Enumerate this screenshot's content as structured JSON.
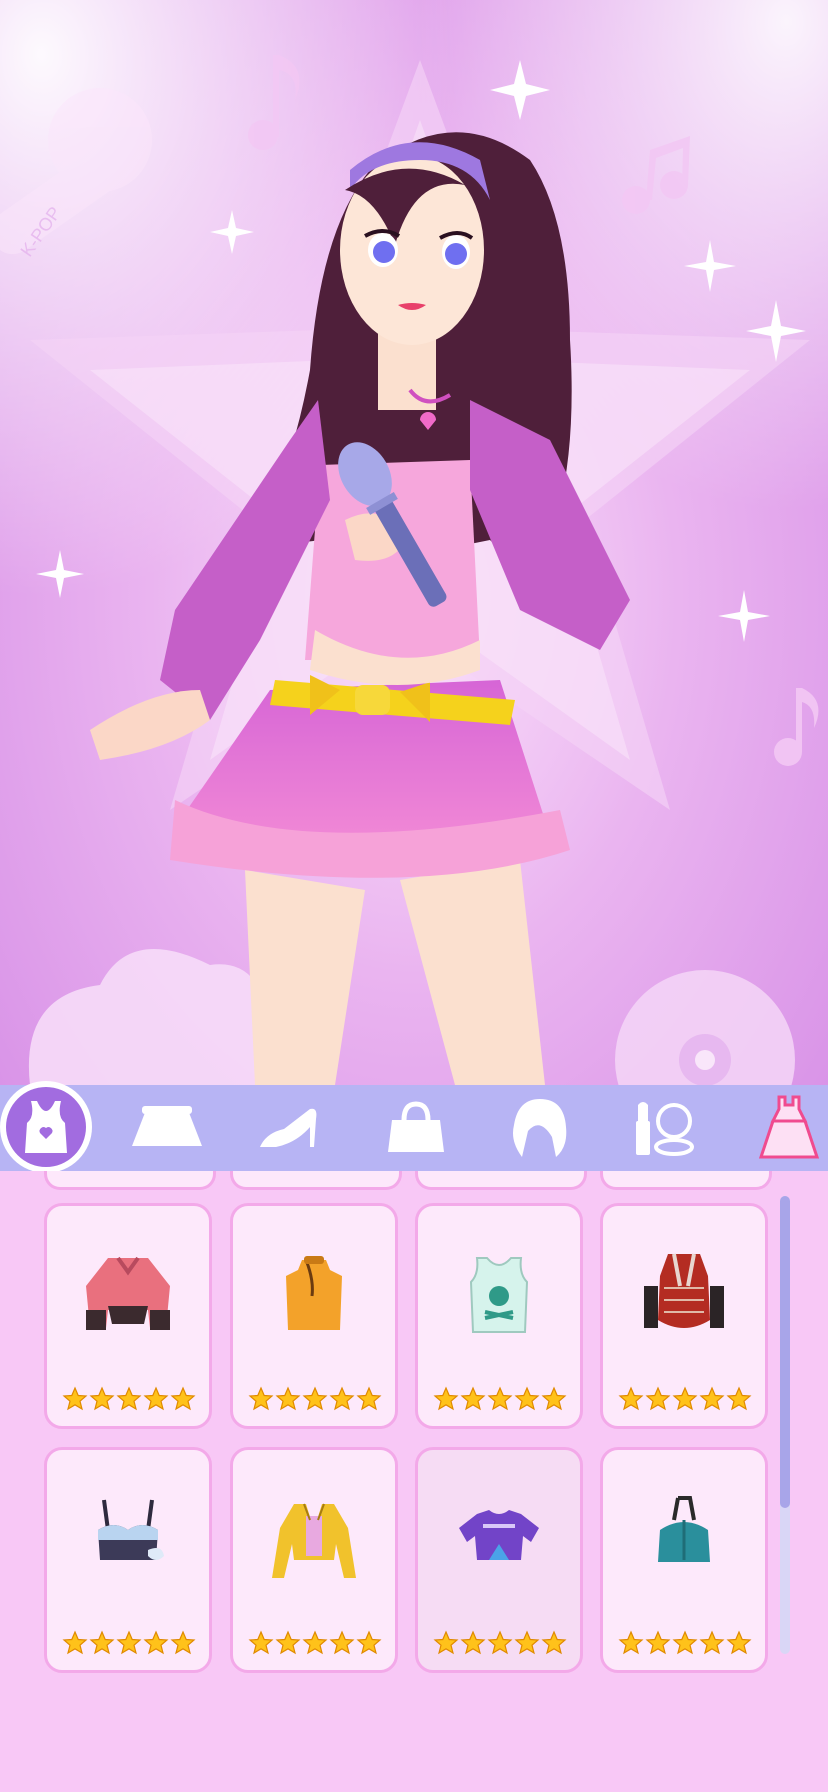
{
  "scene": {
    "background_colors": [
      "#fbe3fb",
      "#eab4f0",
      "#d68ee6"
    ],
    "mic_badge_text": "K-POP"
  },
  "tabs": [
    {
      "id": "tops",
      "icon": "tank-top-icon",
      "active": true
    },
    {
      "id": "skirts",
      "icon": "skirt-icon",
      "active": false
    },
    {
      "id": "shoes",
      "icon": "high-heel-icon",
      "active": false
    },
    {
      "id": "bags",
      "icon": "handbag-icon",
      "active": false
    },
    {
      "id": "hair",
      "icon": "hair-icon",
      "active": false
    },
    {
      "id": "makeup",
      "icon": "makeup-icon",
      "active": false
    },
    {
      "id": "dresses",
      "icon": "dress-icon",
      "active": false
    }
  ],
  "items": [
    {
      "name": "pink-crop-shirt",
      "icon": "pink-shirt-icon",
      "stars": 5,
      "selected": false
    },
    {
      "name": "orange-cheongsam-top",
      "icon": "orange-top-icon",
      "stars": 5,
      "selected": false
    },
    {
      "name": "skull-tank-top",
      "icon": "skull-tank-icon",
      "stars": 5,
      "selected": false
    },
    {
      "name": "red-corset-top",
      "icon": "red-corset-icon",
      "stars": 5,
      "selected": false
    },
    {
      "name": "denim-bustier-top",
      "icon": "bustier-icon",
      "stars": 5,
      "selected": false
    },
    {
      "name": "yellow-jacket",
      "icon": "yellow-jacket-icon",
      "stars": 5,
      "selected": false
    },
    {
      "name": "purple-crop-tee",
      "icon": "purple-tee-icon",
      "stars": 5,
      "selected": true
    },
    {
      "name": "teal-halter-top",
      "icon": "teal-halter-icon",
      "stars": 5,
      "selected": false
    }
  ],
  "colors": {
    "tabbar": "#b7b4f4",
    "active_tab": "#a26ce0",
    "card_border": "#f3a9e9",
    "star": "#ffc21a"
  }
}
